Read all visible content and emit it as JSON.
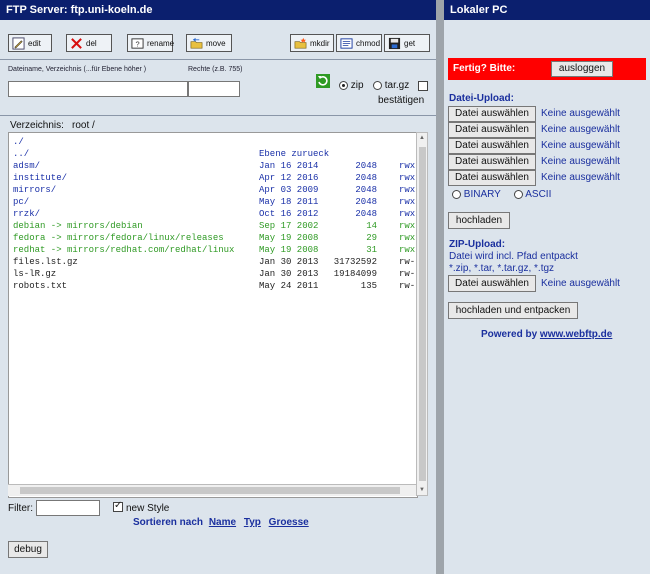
{
  "left_panel": {
    "title": "FTP Server: ftp.uni-koeln.de",
    "toolbar": {
      "edit": "edit",
      "del": "del",
      "rename": "rename",
      "move": "move",
      "mkdir": "mkdir",
      "chmod": "chmod",
      "get": "get"
    },
    "labels": {
      "filename": "Dateiname, Verzeichnis (...für Ebene höher )",
      "rights": "Rechte (z.B. 755)",
      "zip": "zip",
      "targz": "tar.gz",
      "confirm": "bestätigen"
    },
    "directory": {
      "label": "Verzeichnis:",
      "path": "root /"
    },
    "files": [
      {
        "name": "./",
        "date": "",
        "size": "",
        "perm": "",
        "kind": "dir"
      },
      {
        "name": "../",
        "date": "Ebene zurueck",
        "size": "",
        "perm": "",
        "kind": "dir"
      },
      {
        "name": "adsm/",
        "date": "Jan 16 2014",
        "size": "2048",
        "perm": "rwx",
        "kind": "dir"
      },
      {
        "name": "institute/",
        "date": "Apr 12 2016",
        "size": "2048",
        "perm": "rwx",
        "kind": "dir"
      },
      {
        "name": "mirrors/",
        "date": "Apr 03 2009",
        "size": "2048",
        "perm": "rwx",
        "kind": "dir"
      },
      {
        "name": "pc/",
        "date": "May 18 2011",
        "size": "2048",
        "perm": "rwx",
        "kind": "dir"
      },
      {
        "name": "rrzk/",
        "date": "Oct 16 2012",
        "size": "2048",
        "perm": "rwx",
        "kind": "dir"
      },
      {
        "name": "debian -> mirrors/debian",
        "date": "Sep 17 2002",
        "size": "14",
        "perm": "rwx",
        "kind": "link"
      },
      {
        "name": "fedora -> mirrors/fedora/linux/releases",
        "date": "May 19 2008",
        "size": "29",
        "perm": "rwx",
        "kind": "link"
      },
      {
        "name": "redhat -> mirrors/redhat.com/redhat/linux",
        "date": "May 19 2008",
        "size": "31",
        "perm": "rwx",
        "kind": "link"
      },
      {
        "name": "files.lst.gz",
        "date": "Jan 30 2013",
        "size": "31732592",
        "perm": "rw-",
        "kind": "file"
      },
      {
        "name": "ls-lR.gz",
        "date": "Jan 30 2013",
        "size": "19184099",
        "perm": "rw-",
        "kind": "file"
      },
      {
        "name": "robots.txt",
        "date": "May 24 2011",
        "size": "135",
        "perm": "rw-",
        "kind": "file"
      }
    ],
    "filter_label": "Filter:",
    "new_style": "new Style",
    "sort_label": "Sortieren nach",
    "sort_name": "Name",
    "sort_type": "Typ",
    "sort_size": "Groesse",
    "debug": "debug"
  },
  "right_panel": {
    "title": "Lokaler PC",
    "done_label": "Fertig? Bitte:",
    "logout": "ausloggen",
    "upload_heading": "Datei-Upload:",
    "choose_file": "Datei auswählen",
    "none_selected": "Keine ausgewählt",
    "binary": "BINARY",
    "ascii": "ASCII",
    "upload_button": "hochladen",
    "zip_heading": "ZIP-Upload:",
    "zip_note": "Datei wird incl. Pfad entpackt",
    "zip_types": "*.zip, *.tar, *.tar.gz, *.tgz",
    "upload_unpack": "hochladen und entpacken",
    "powered": "Powered by",
    "powered_link": "www.webftp.de"
  },
  "colors": {
    "titlebar": "#0b1f6e",
    "alert": "#ff0000",
    "dir": "#1a30a8",
    "link": "#2f9a24"
  }
}
